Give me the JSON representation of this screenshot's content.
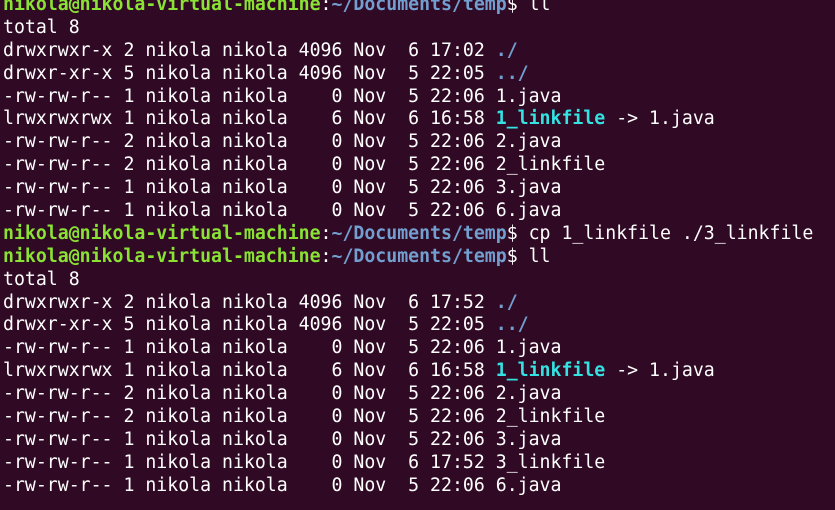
{
  "window": {
    "background": "#300a24",
    "colors": {
      "user_host": "#8ae234",
      "path": "#729fcf",
      "directory": "#729fcf",
      "symlink": "#34e2e2",
      "text": "#ffffff"
    }
  },
  "lines": [
    {
      "type": "prompt",
      "user": "nikola@nikola-virtual-machine",
      "sep": ":",
      "path": "~/Documents/temp",
      "dollar": "$ ",
      "cmd": "ll"
    },
    {
      "type": "text",
      "text": "total 8"
    },
    {
      "type": "entry",
      "meta": "drwxrwxr-x 2 nikola nikola 4096 Nov  6 17:02 ",
      "name": "./",
      "kind": "dir",
      "target": ""
    },
    {
      "type": "entry",
      "meta": "drwxr-xr-x 5 nikola nikola 4096 Nov  5 22:05 ",
      "name": "../",
      "kind": "dir",
      "target": ""
    },
    {
      "type": "entry",
      "meta": "-rw-rw-r-- 1 nikola nikola    0 Nov  5 22:06 ",
      "name": "1.java",
      "kind": "file",
      "target": ""
    },
    {
      "type": "entry",
      "meta": "lrwxrwxrwx 1 nikola nikola    6 Nov  6 16:58 ",
      "name": "1_linkfile",
      "kind": "link",
      "target": " -> 1.java"
    },
    {
      "type": "entry",
      "meta": "-rw-rw-r-- 2 nikola nikola    0 Nov  5 22:06 ",
      "name": "2.java",
      "kind": "file",
      "target": ""
    },
    {
      "type": "entry",
      "meta": "-rw-rw-r-- 2 nikola nikola    0 Nov  5 22:06 ",
      "name": "2_linkfile",
      "kind": "file",
      "target": ""
    },
    {
      "type": "entry",
      "meta": "-rw-rw-r-- 1 nikola nikola    0 Nov  5 22:06 ",
      "name": "3.java",
      "kind": "file",
      "target": ""
    },
    {
      "type": "entry",
      "meta": "-rw-rw-r-- 1 nikola nikola    0 Nov  5 22:06 ",
      "name": "6.java",
      "kind": "file",
      "target": ""
    },
    {
      "type": "prompt",
      "user": "nikola@nikola-virtual-machine",
      "sep": ":",
      "path": "~/Documents/temp",
      "dollar": "$ ",
      "cmd": "cp 1_linkfile ./3_linkfile"
    },
    {
      "type": "prompt",
      "user": "nikola@nikola-virtual-machine",
      "sep": ":",
      "path": "~/Documents/temp",
      "dollar": "$ ",
      "cmd": "ll"
    },
    {
      "type": "text",
      "text": "total 8"
    },
    {
      "type": "entry",
      "meta": "drwxrwxr-x 2 nikola nikola 4096 Nov  6 17:52 ",
      "name": "./",
      "kind": "dir",
      "target": ""
    },
    {
      "type": "entry",
      "meta": "drwxr-xr-x 5 nikola nikola 4096 Nov  5 22:05 ",
      "name": "../",
      "kind": "dir",
      "target": ""
    },
    {
      "type": "entry",
      "meta": "-rw-rw-r-- 1 nikola nikola    0 Nov  5 22:06 ",
      "name": "1.java",
      "kind": "file",
      "target": ""
    },
    {
      "type": "entry",
      "meta": "lrwxrwxrwx 1 nikola nikola    6 Nov  6 16:58 ",
      "name": "1_linkfile",
      "kind": "link",
      "target": " -> 1.java"
    },
    {
      "type": "entry",
      "meta": "-rw-rw-r-- 2 nikola nikola    0 Nov  5 22:06 ",
      "name": "2.java",
      "kind": "file",
      "target": ""
    },
    {
      "type": "entry",
      "meta": "-rw-rw-r-- 2 nikola nikola    0 Nov  5 22:06 ",
      "name": "2_linkfile",
      "kind": "file",
      "target": ""
    },
    {
      "type": "entry",
      "meta": "-rw-rw-r-- 1 nikola nikola    0 Nov  5 22:06 ",
      "name": "3.java",
      "kind": "file",
      "target": ""
    },
    {
      "type": "entry",
      "meta": "-rw-rw-r-- 1 nikola nikola    0 Nov  6 17:52 ",
      "name": "3_linkfile",
      "kind": "file",
      "target": ""
    },
    {
      "type": "entry",
      "meta": "-rw-rw-r-- 1 nikola nikola    0 Nov  5 22:06 ",
      "name": "6.java",
      "kind": "file",
      "target": ""
    }
  ]
}
